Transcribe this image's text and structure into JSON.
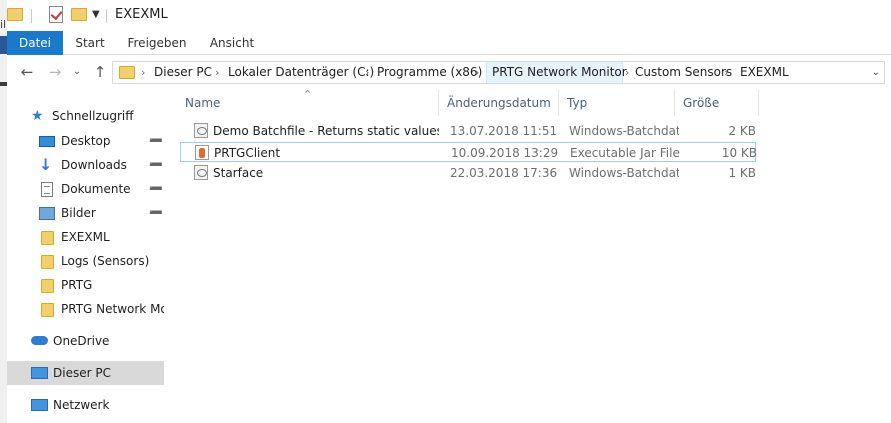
{
  "window": {
    "title": "EXEXML",
    "background_partial_char": "il"
  },
  "ribbon": {
    "tabs": [
      {
        "label": "Datei",
        "active": true
      },
      {
        "label": "Start"
      },
      {
        "label": "Freigeben"
      },
      {
        "label": "Ansicht"
      }
    ]
  },
  "address": {
    "crumbs": [
      "Dieser PC",
      "Lokaler Datenträger (C:)",
      "Programme (x86)",
      "PRTG Network Monitor",
      "Custom Sensors",
      "EXEXML"
    ],
    "highlighted_crumb": "PRTG Network Monitor"
  },
  "navigation": {
    "quick_access": "Schnellzugriff",
    "items": [
      {
        "label": "Desktop",
        "icon": "desktop-icon",
        "pinned": true
      },
      {
        "label": "Downloads",
        "icon": "download-arrow-icon",
        "pinned": true
      },
      {
        "label": "Dokumente",
        "icon": "document-icon",
        "pinned": true
      },
      {
        "label": "Bilder",
        "icon": "pictures-icon",
        "pinned": true
      },
      {
        "label": "EXEXML",
        "icon": "folder-icon"
      },
      {
        "label": "Logs (Sensors)",
        "icon": "folder-icon"
      },
      {
        "label": "PRTG",
        "icon": "folder-icon"
      },
      {
        "label": "PRTG Network Mon",
        "icon": "folder-icon"
      }
    ],
    "onedrive": "OneDrive",
    "this_pc": "Dieser PC",
    "network": "Netzwerk",
    "selected": "Dieser PC"
  },
  "columns": {
    "name": "Name",
    "date": "Änderungsdatum",
    "type": "Typ",
    "size": "Größe"
  },
  "files": [
    {
      "name": "Demo Batchfile - Returns static values in ...",
      "date": "13.07.2018 11:51",
      "type": "Windows-Batchdat...",
      "size": "2 KB",
      "icon": "batch-file-icon"
    },
    {
      "name": "PRTGClient",
      "date": "10.09.2018 13:29",
      "type": "Executable Jar File",
      "size": "10 KB",
      "icon": "jar-file-icon",
      "selected": true
    },
    {
      "name": "Starface",
      "date": "22.03.2018 17:36",
      "type": "Windows-Batchdat...",
      "size": "1 KB",
      "icon": "batch-file-icon"
    }
  ],
  "colors": {
    "accent": "#1979ca",
    "folder": "#f3cf6c",
    "selection_border": "#99d1ff",
    "nav_selected": "#d9d9d9"
  }
}
